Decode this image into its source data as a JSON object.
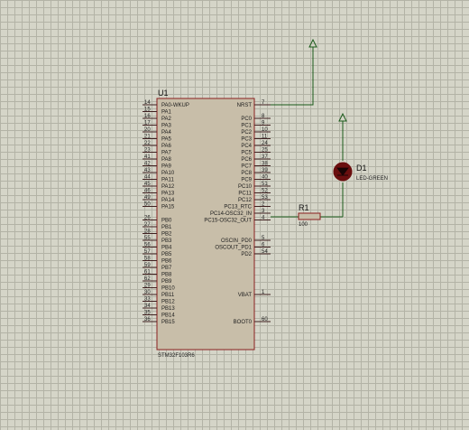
{
  "colors": {
    "sheet": "#d5d5c8",
    "grid": "#b3b3a6",
    "chip_body": "#c8bea9",
    "chip_outline": "#8a2020",
    "wire": "#1a5a1a",
    "pin": "#402020",
    "led_body": "#6a0f0f",
    "resistor_body": "#c8bea9"
  },
  "schematic": {
    "chip": {
      "ref": "U1",
      "part": "STM32F103R6",
      "left_pins": [
        {
          "num": "14",
          "name": "PA0-WKUP"
        },
        {
          "num": "15",
          "name": "PA1"
        },
        {
          "num": "16",
          "name": "PA2"
        },
        {
          "num": "17",
          "name": "PA3"
        },
        {
          "num": "20",
          "name": "PA4"
        },
        {
          "num": "21",
          "name": "PA5"
        },
        {
          "num": "22",
          "name": "PA6"
        },
        {
          "num": "23",
          "name": "PA7"
        },
        {
          "num": "41",
          "name": "PA8"
        },
        {
          "num": "42",
          "name": "PA9"
        },
        {
          "num": "43",
          "name": "PA10"
        },
        {
          "num": "44",
          "name": "PA11"
        },
        {
          "num": "45",
          "name": "PA12"
        },
        {
          "num": "46",
          "name": "PA13"
        },
        {
          "num": "49",
          "name": "PA14"
        },
        {
          "num": "50",
          "name": "PA15"
        },
        {
          "num": "",
          "name": ""
        },
        {
          "num": "26",
          "name": "PB0"
        },
        {
          "num": "27",
          "name": "PB1"
        },
        {
          "num": "28",
          "name": "PB2"
        },
        {
          "num": "55",
          "name": "PB3"
        },
        {
          "num": "56",
          "name": "PB4"
        },
        {
          "num": "57",
          "name": "PB5"
        },
        {
          "num": "58",
          "name": "PB6"
        },
        {
          "num": "59",
          "name": "PB7"
        },
        {
          "num": "61",
          "name": "PB8"
        },
        {
          "num": "62",
          "name": "PB9"
        },
        {
          "num": "29",
          "name": "PB10"
        },
        {
          "num": "30",
          "name": "PB11"
        },
        {
          "num": "33",
          "name": "PB12"
        },
        {
          "num": "34",
          "name": "PB13"
        },
        {
          "num": "35",
          "name": "PB14"
        },
        {
          "num": "36",
          "name": "PB15"
        }
      ],
      "right_pins": [
        {
          "num": "7",
          "name": "NRST",
          "slot": 0
        },
        {
          "num": "8",
          "name": "PC0",
          "slot": 2
        },
        {
          "num": "9",
          "name": "PC1",
          "slot": 3
        },
        {
          "num": "10",
          "name": "PC2",
          "slot": 4
        },
        {
          "num": "11",
          "name": "PC3",
          "slot": 5
        },
        {
          "num": "24",
          "name": "PC4",
          "slot": 6
        },
        {
          "num": "25",
          "name": "PC5",
          "slot": 7
        },
        {
          "num": "37",
          "name": "PC6",
          "slot": 8
        },
        {
          "num": "38",
          "name": "PC7",
          "slot": 9
        },
        {
          "num": "39",
          "name": "PC8",
          "slot": 10
        },
        {
          "num": "40",
          "name": "PC9",
          "slot": 11
        },
        {
          "num": "51",
          "name": "PC10",
          "slot": 12
        },
        {
          "num": "52",
          "name": "PC11",
          "slot": 13
        },
        {
          "num": "53",
          "name": "PC12",
          "slot": 14
        },
        {
          "num": "2",
          "name": "PC13_RTC",
          "slot": 15
        },
        {
          "num": "3",
          "name": "PC14-OSC32_IN",
          "slot": 16
        },
        {
          "num": "4",
          "name": "PC15-OSC32_OUT",
          "slot": 17
        },
        {
          "num": "5",
          "name": "OSCIN_PD0",
          "slot": 20
        },
        {
          "num": "6",
          "name": "OSCOUT_PD1",
          "slot": 21
        },
        {
          "num": "54",
          "name": "PD2",
          "slot": 22
        },
        {
          "num": "1",
          "name": "VBAT",
          "slot": 28
        },
        {
          "num": "60",
          "name": "BOOT0",
          "slot": 32
        }
      ]
    },
    "resistor": {
      "ref": "R1",
      "value": "100"
    },
    "led": {
      "ref": "D1",
      "value": "LED-GREEN"
    }
  }
}
